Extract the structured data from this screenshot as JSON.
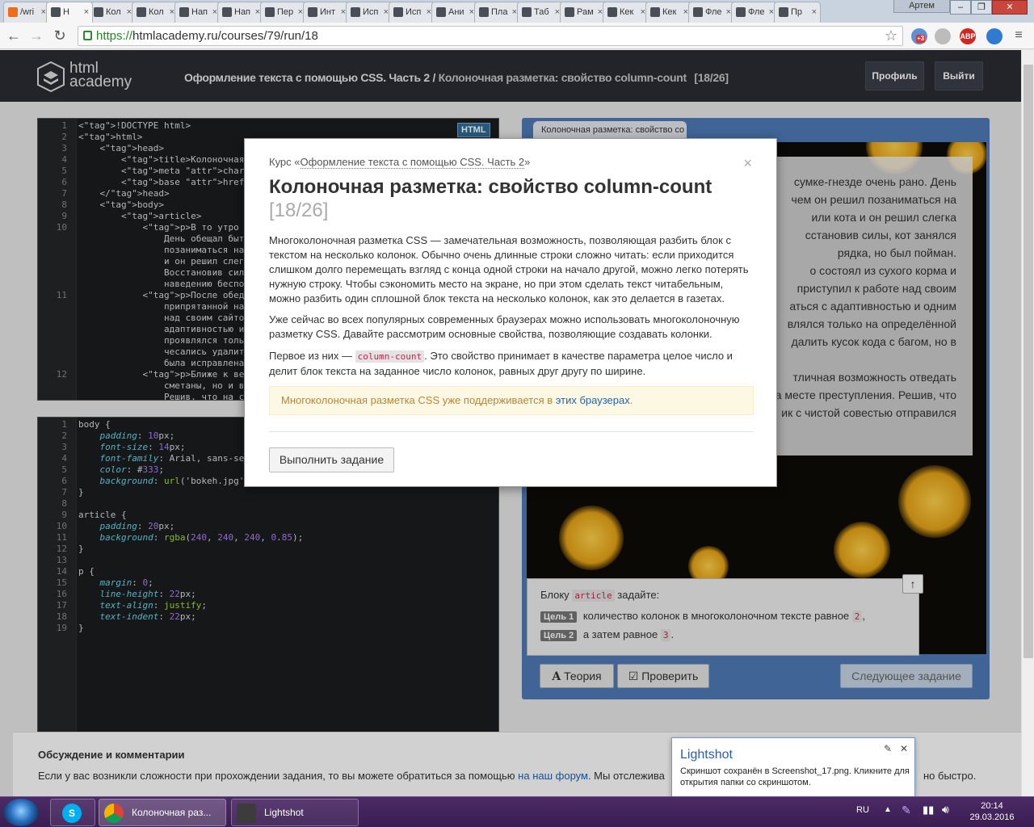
{
  "browser": {
    "tabs": [
      {
        "label": "/wri"
      },
      {
        "label": "Н"
      },
      {
        "label": "Кол"
      },
      {
        "label": "Кол"
      },
      {
        "label": "Нап"
      },
      {
        "label": "Нап"
      },
      {
        "label": "Пер"
      },
      {
        "label": "Инт"
      },
      {
        "label": "Исп"
      },
      {
        "label": "Исп"
      },
      {
        "label": "Ани"
      },
      {
        "label": "Пла"
      },
      {
        "label": "Таб"
      },
      {
        "label": "Рам"
      },
      {
        "label": "Кек"
      },
      {
        "label": "Кек"
      },
      {
        "label": "Фле"
      },
      {
        "label": "Фле"
      },
      {
        "label": "Пр"
      }
    ],
    "user": "Артем",
    "url_scheme": "https://",
    "url_rest": "htmlacademy.ru/courses/79/run/18",
    "ext_badge": "+3",
    "abp": "ABP"
  },
  "header": {
    "logo_line1": "html",
    "logo_line2": "academy",
    "course_title": "Оформление текста с помощью CSS. Часть 2 /",
    "lesson_title": "Колоночная разметка: свойство column-count",
    "progress": "[18/26]",
    "profile_button": "Профиль",
    "logout_button": "Выйти"
  },
  "html_editor": {
    "badge": "HTML",
    "lines": [
      {
        "n": "1",
        "code": "<!DOCTYPE html>"
      },
      {
        "n": "2",
        "code": "<html>"
      },
      {
        "n": "3",
        "code": "    <head>"
      },
      {
        "n": "4",
        "code": "        <title>Колоночная размет"
      },
      {
        "n": "5",
        "code": "        <meta charset=\"utf-8\">"
      },
      {
        "n": "6",
        "code": "        <base href=\"/assets/cour"
      },
      {
        "n": "7",
        "code": "    </head>"
      },
      {
        "n": "8",
        "code": "    <body>"
      },
      {
        "n": "9",
        "code": "        <article>"
      },
      {
        "n": "10",
        "code": "            <p>В то утро Кексик"
      },
      {
        "n": "",
        "code": "                День обещал быт"
      },
      {
        "n": "",
        "code": "                позаниматься на"
      },
      {
        "n": "",
        "code": "                и он решил слег"
      },
      {
        "n": "",
        "code": "                Восстановив сил"
      },
      {
        "n": "",
        "code": "                наведению беспо"
      },
      {
        "n": "11",
        "code": "            <p>После обеда, кот"
      },
      {
        "n": "",
        "code": "                припрятанной на"
      },
      {
        "n": "",
        "code": "                над своим сайто"
      },
      {
        "n": "",
        "code": "                адаптивностью и"
      },
      {
        "n": "",
        "code": "                проявлялся толь"
      },
      {
        "n": "",
        "code": "                чесались удалит"
      },
      {
        "n": "",
        "code": "                была исправлена"
      },
      {
        "n": "12",
        "code": "            <p>Ближе к вечеру п"
      },
      {
        "n": "",
        "code": "                сметаны, но и в"
      },
      {
        "n": "",
        "code": "                Решив, что на с"
      }
    ]
  },
  "css_editor": {
    "lines": [
      {
        "n": "1",
        "code": "body {"
      },
      {
        "n": "2",
        "code": "    padding: 10px;"
      },
      {
        "n": "3",
        "code": "    font-size: 14px;"
      },
      {
        "n": "4",
        "code": "    font-family: Arial, sans-se"
      },
      {
        "n": "5",
        "code": "    color: #333;"
      },
      {
        "n": "6",
        "code": "    background: url('bokeh.jpg'"
      },
      {
        "n": "7",
        "code": "}"
      },
      {
        "n": "8",
        "code": ""
      },
      {
        "n": "9",
        "code": "article {"
      },
      {
        "n": "10",
        "code": "    padding: 20px;"
      },
      {
        "n": "11",
        "code": "    background: rgba(240, 240, 240, 0.85);"
      },
      {
        "n": "12",
        "code": "}"
      },
      {
        "n": "13",
        "code": ""
      },
      {
        "n": "14",
        "code": "p {"
      },
      {
        "n": "15",
        "code": "    margin: 0;"
      },
      {
        "n": "16",
        "code": "    line-height: 22px;"
      },
      {
        "n": "17",
        "code": "    text-align: justify;"
      },
      {
        "n": "18",
        "code": "    text-indent: 22px;"
      },
      {
        "n": "19",
        "code": "}"
      }
    ]
  },
  "preview": {
    "tab_label": "Колоночная разметка: свойство co",
    "article_lines": [
      "сумке-гнезде очень рано. День",
      "чем он решил позаниматься на",
      "или кота и он решил слегка",
      "сстановив силы, кот занялся",
      "рядка, но был пойман.",
      "о состоял из сухого корма и",
      "приступил к работе над своим",
      "аться с адаптивностью и одним",
      "влялся только на определённой",
      "далить кусок кода с багом, но в",
      "",
      "тличная возможность отведать",
      "а месте преступления. Решив, что",
      "ик с чистой совестью отправился"
    ],
    "task_intro_before": "Блоку",
    "task_intro_code": "article",
    "task_intro_after": "задайте:",
    "goal1_label": "Цель 1",
    "goal1_text": "количество колонок в многоколоночном тексте равное",
    "goal1_value": "2",
    "goal2_label": "Цель 2",
    "goal2_text": "а затем равное",
    "goal2_value": "3",
    "theory_button": "Теория",
    "check_button": "Проверить",
    "next_button": "Следующее задание"
  },
  "discussion": {
    "title": "Обсуждение и комментарии",
    "text_before": "Если у вас возникли сложности при прохождении задания, то вы можете обратиться за помощью",
    "link": "на наш форум",
    "text_after": ". Мы отслежива",
    "text_tail": "но быстро."
  },
  "modal": {
    "course_prefix": "Курс «",
    "course_link": "Оформление текста с помощью CSS. Часть 2",
    "course_suffix": "»",
    "title": "Колоночная разметка: свойство column-count",
    "count": "[18/26]",
    "p1": "Многоколоночная разметка CSS — замечательная возможность, позволяющая разбить блок с текстом на несколько колонок. Обычно очень длинные строки сложно читать: если приходится слишком долго перемещать взгляд с конца одной строки на начало другой, можно легко потерять нужную строку. Чтобы сэкономить место на экране, но при этом сделать текст читабельным, можно разбить один сплошной блок текста на несколько колонок, как это делается в газетах.",
    "p2": "Уже сейчас во всех популярных современных браузерах можно использовать многоколоночную разметку CSS. Давайте рассмотрим основные свойства, позволяющие создавать колонки.",
    "p3_before": "Первое из них —",
    "p3_code": "column-count",
    "p3_after": ". Это свойство принимает в качестве параметра целое число и делит блок текста на заданное число колонок, равных друг другу по ширине.",
    "notice_text": "Многоколоночная разметка CSS уже поддерживается в",
    "notice_link": "этих браузерах",
    "notice_end": ".",
    "button": "Выполнить задание",
    "close": "×"
  },
  "toast": {
    "title": "Lightshot",
    "message": "Скриншот сохранён в Screenshot_17.png. Кликните для открытия папки со скриншотом."
  },
  "taskbar": {
    "item1": "Колоночная раз...",
    "item2": "Lightshot",
    "lang": "RU",
    "time": "20:14",
    "date": "29.03.2016"
  }
}
